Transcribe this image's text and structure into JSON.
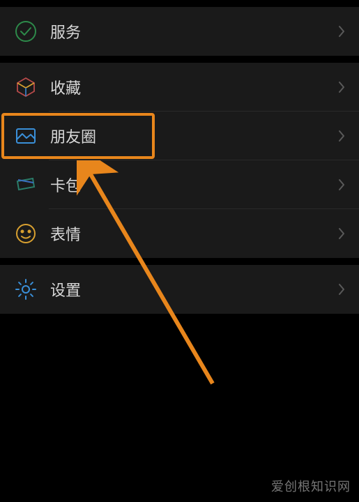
{
  "menu": {
    "group1": [
      {
        "id": "services",
        "label": "服务",
        "icon": "service-check-icon"
      }
    ],
    "group2": [
      {
        "id": "favorites",
        "label": "收藏",
        "icon": "cube-icon"
      },
      {
        "id": "moments",
        "label": "朋友圈",
        "icon": "gallery-icon"
      },
      {
        "id": "cards",
        "label": "卡包",
        "icon": "wallet-icon"
      },
      {
        "id": "stickers",
        "label": "表情",
        "icon": "smiley-icon"
      }
    ],
    "group3": [
      {
        "id": "settings",
        "label": "设置",
        "icon": "gear-icon"
      }
    ]
  },
  "watermark": "爱创根知识网",
  "annotation": {
    "highlight_target": "moments",
    "highlight_color": "#e8861c"
  }
}
